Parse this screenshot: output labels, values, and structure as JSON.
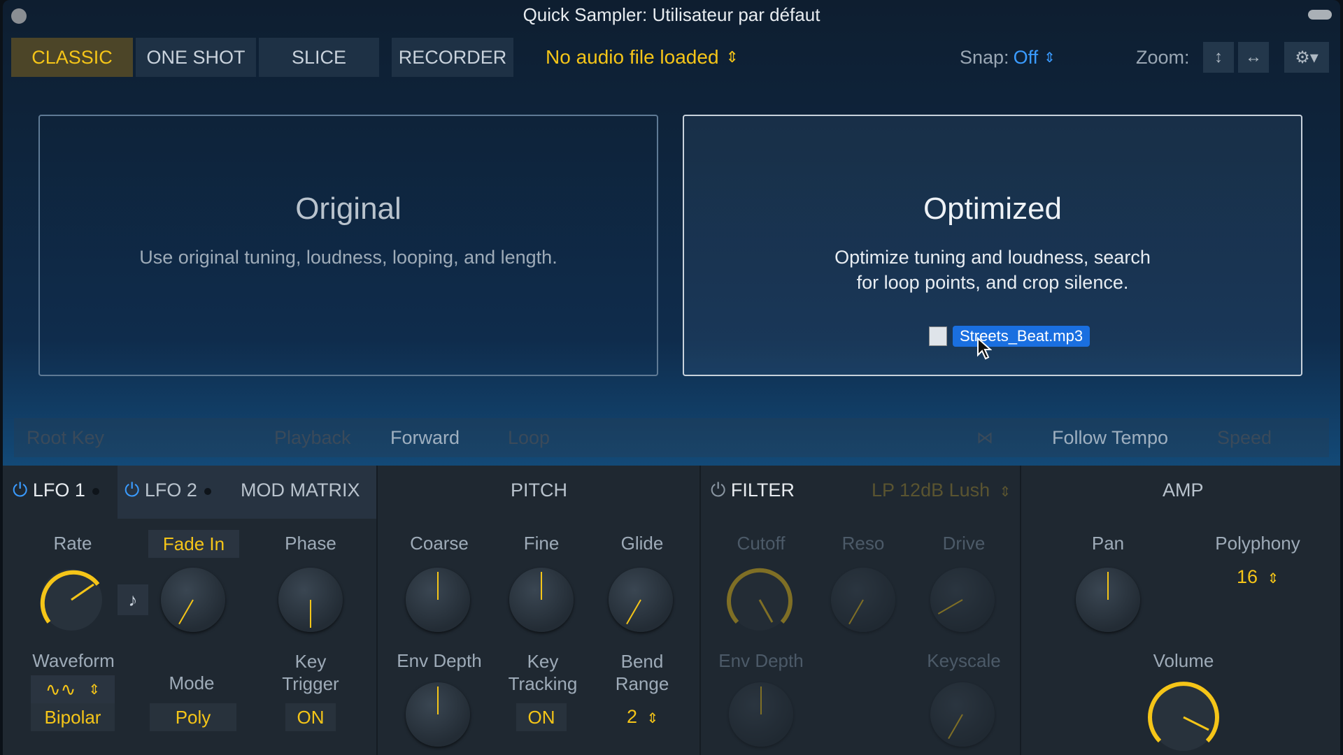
{
  "window": {
    "title": "Quick Sampler: Utilisateur par défaut"
  },
  "toolbar": {
    "modes": [
      "CLASSIC",
      "ONE SHOT",
      "SLICE"
    ],
    "active_mode": "CLASSIC",
    "recorder": "RECORDER",
    "audio_file": "No audio file loaded",
    "snap_label": "Snap:",
    "snap_value": "Off",
    "zoom_label": "Zoom:"
  },
  "panels": {
    "original": {
      "title": "Original",
      "desc": "Use original tuning, loudness, looping, and length."
    },
    "optimized": {
      "title": "Optimized",
      "desc_line1": "Optimize tuning and loudness, search",
      "desc_line2": "for loop points, and crop silence.",
      "drag_file": "Streets_Beat.mp3"
    }
  },
  "playbar": {
    "root_key": "Root Key",
    "playback": "Playback",
    "forward": "Forward",
    "loop": "Loop",
    "follow_tempo": "Follow Tempo",
    "speed": "Speed"
  },
  "lfo": {
    "tab1": "LFO 1",
    "tab2": "LFO 2",
    "tab3": "MOD MATRIX",
    "rate": "Rate",
    "fade_in": "Fade In",
    "phase": "Phase",
    "waveform": "Waveform",
    "mode": "Mode",
    "key_trigger_1": "Key",
    "key_trigger_2": "Trigger",
    "bipolar": "Bipolar",
    "poly": "Poly",
    "on": "ON"
  },
  "pitch": {
    "title": "PITCH",
    "coarse": "Coarse",
    "fine": "Fine",
    "glide": "Glide",
    "env_depth": "Env Depth",
    "key_tracking_1": "Key",
    "key_tracking_2": "Tracking",
    "bend_range_1": "Bend",
    "bend_range_2": "Range",
    "key_tracking_value": "ON",
    "bend_range_value": "2"
  },
  "filter": {
    "title": "FILTER",
    "type": "LP 12dB Lush",
    "cutoff": "Cutoff",
    "reso": "Reso",
    "drive": "Drive",
    "env_depth": "Env Depth",
    "keyscale": "Keyscale"
  },
  "amp": {
    "title": "AMP",
    "pan": "Pan",
    "polyphony": "Polyphony",
    "polyphony_value": "16",
    "volume": "Volume"
  },
  "colors": {
    "accent": "#f5c518",
    "blue": "#3a9bff",
    "panel_bg": "#1f2831"
  }
}
